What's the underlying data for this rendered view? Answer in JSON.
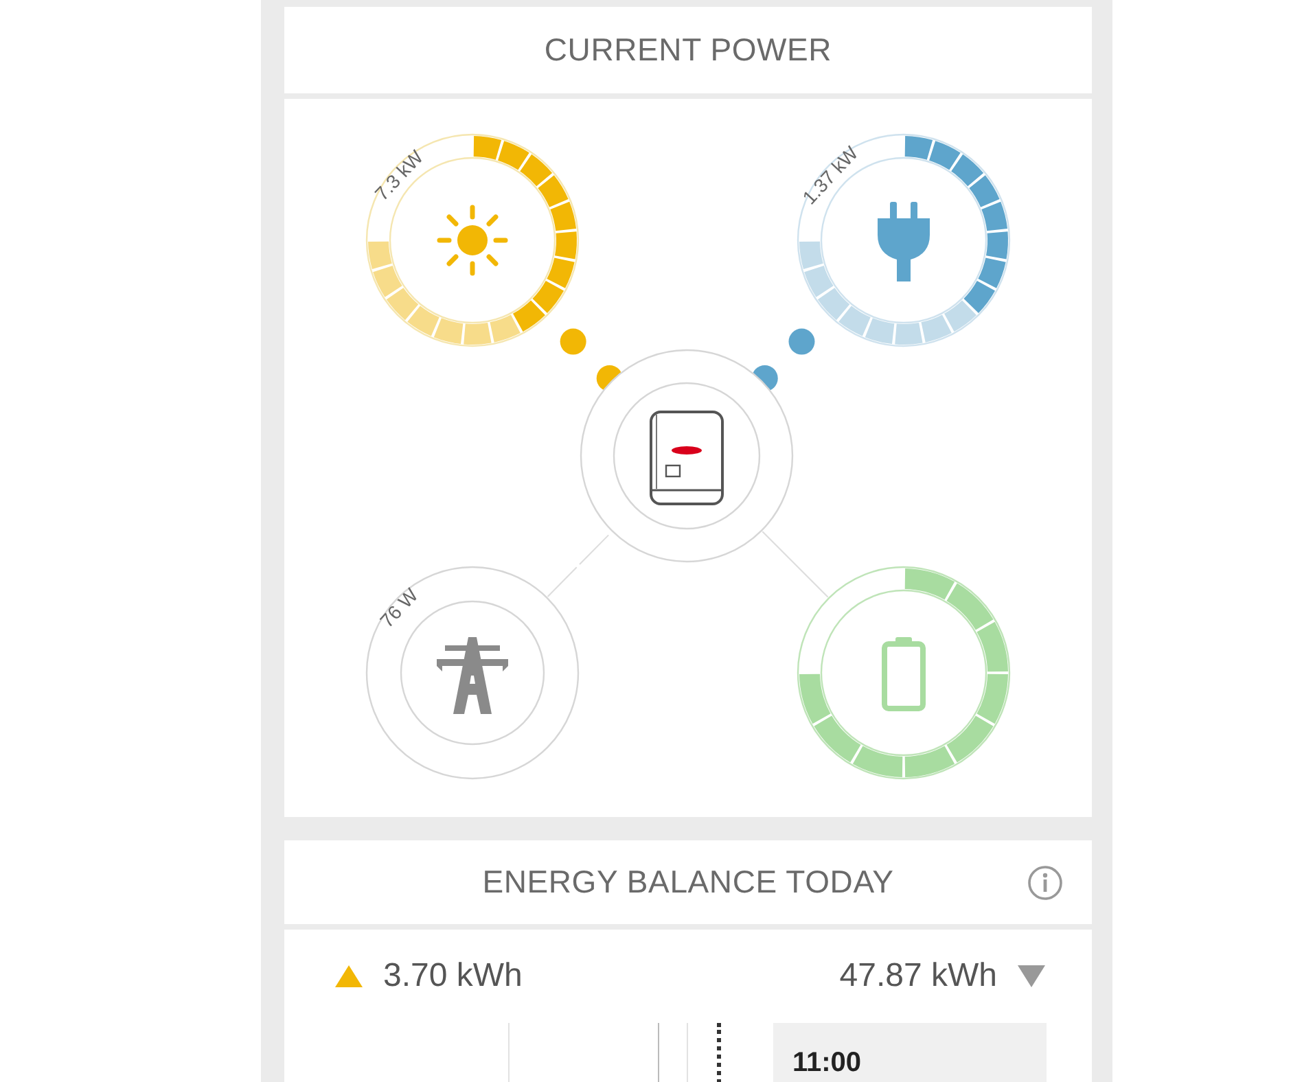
{
  "current_power": {
    "title": "CURRENT POWER",
    "nodes": [
      {
        "kind": "pv",
        "reading": "7.3 kW",
        "level": 0.55
      },
      {
        "kind": "load",
        "reading": "1.37 kW",
        "level": 0.53
      },
      {
        "kind": "inverter"
      },
      {
        "kind": "grid",
        "reading": "76 W"
      },
      {
        "kind": "battery"
      }
    ]
  },
  "energy_balance": {
    "title": "ENERGY BALANCE TODAY",
    "produced": "3.70 kWh",
    "consumed": "47.87 kWh",
    "timeline": {
      "time": "11:00"
    }
  }
}
